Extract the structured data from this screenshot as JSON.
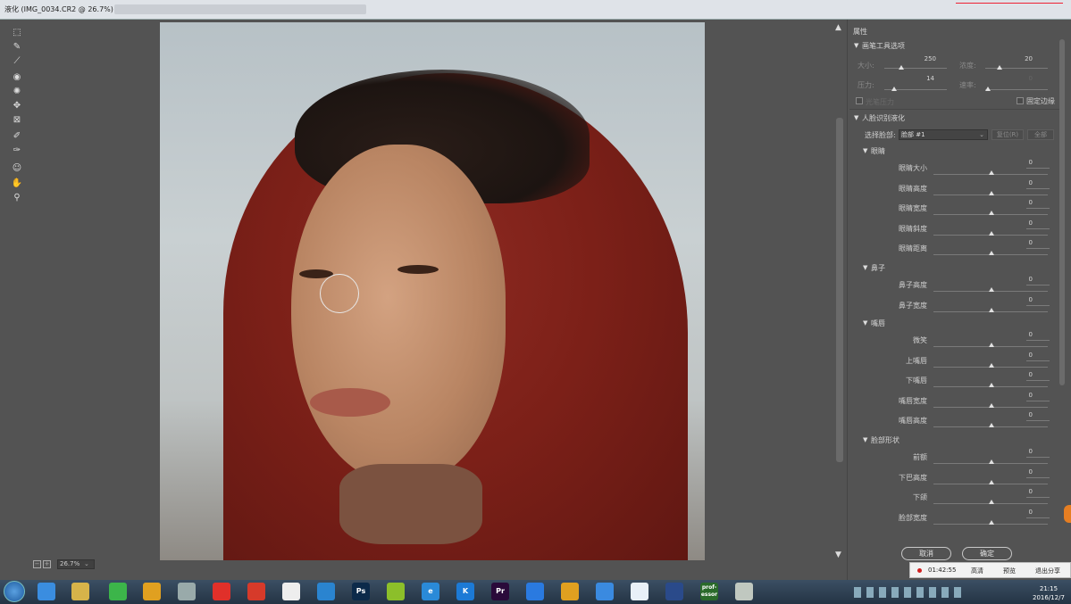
{
  "window": {
    "title": "液化 (IMG_0034.CR2 @ 26.7%)"
  },
  "tools": [
    {
      "name": "forward-warp-tool",
      "glyph": "⬚"
    },
    {
      "name": "reconstruct-tool",
      "glyph": "✎"
    },
    {
      "name": "smooth-tool",
      "glyph": "⟋"
    },
    {
      "name": "twirl-tool",
      "glyph": "◉"
    },
    {
      "name": "pucker-tool",
      "glyph": "✺"
    },
    {
      "name": "bloat-tool",
      "glyph": "✥"
    },
    {
      "name": "push-left-tool",
      "glyph": "⊠"
    },
    {
      "name": "freeze-mask-tool",
      "glyph": "✐"
    },
    {
      "name": "thaw-mask-tool",
      "glyph": "✑"
    },
    {
      "name": "face-tool",
      "glyph": "☺"
    },
    {
      "name": "hand-tool",
      "glyph": "✋"
    },
    {
      "name": "zoom-tool",
      "glyph": "⚲"
    }
  ],
  "status": {
    "zoom": "26.7%"
  },
  "panel": {
    "header": "属性",
    "brush_section": "画笔工具选项",
    "size_label": "大小:",
    "size_value": "250",
    "density_label": "浓度:",
    "density_value": "20",
    "pressure_label": "压力:",
    "pressure_value": "14",
    "rate_label": "速率:",
    "rate_value": "0",
    "stylus_label": "光笔压力",
    "pin_edges_label": "固定边缘",
    "face_section": "人脸识别液化",
    "select_face_label": "选择脸部:",
    "select_face_value": "脸部 #1",
    "reset_label": "复位(R)",
    "all_label": "全部",
    "eyes_section": "眼睛",
    "eye_sliders": [
      {
        "label": "眼睛大小",
        "value": "0"
      },
      {
        "label": "眼睛高度",
        "value": "0"
      },
      {
        "label": "眼睛宽度",
        "value": "0"
      },
      {
        "label": "眼睛斜度",
        "value": "0"
      },
      {
        "label": "眼睛距离",
        "value": "0"
      }
    ],
    "nose_section": "鼻子",
    "nose_sliders": [
      {
        "label": "鼻子高度",
        "value": "0"
      },
      {
        "label": "鼻子宽度",
        "value": "0"
      }
    ],
    "mouth_section": "嘴唇",
    "mouth_sliders": [
      {
        "label": "微笑",
        "value": "0"
      },
      {
        "label": "上嘴唇",
        "value": "0"
      },
      {
        "label": "下嘴唇",
        "value": "0"
      },
      {
        "label": "嘴唇宽度",
        "value": "0"
      },
      {
        "label": "嘴唇高度",
        "value": "0"
      }
    ],
    "faceshape_section": "脸部形状",
    "faceshape_sliders": [
      {
        "label": "前额",
        "value": "0"
      },
      {
        "label": "下巴高度",
        "value": "0"
      },
      {
        "label": "下颌",
        "value": "0"
      },
      {
        "label": "脸部宽度",
        "value": "0"
      }
    ],
    "cancel_label": "取消",
    "ok_label": "确定"
  },
  "recorder": {
    "time": "01:42:55",
    "hd": "高清",
    "preview": "预览",
    "exit": "退出分享"
  },
  "taskbar": {
    "apps": [
      {
        "name": "app-360",
        "label": "",
        "color": "#3a8de0"
      },
      {
        "name": "explorer",
        "label": "",
        "color": "#d6b34a"
      },
      {
        "name": "app-green",
        "label": "",
        "color": "#3cb54a"
      },
      {
        "name": "chrome",
        "label": "",
        "color": "#e0a020"
      },
      {
        "name": "app-cat",
        "label": "",
        "color": "#9aa"
      },
      {
        "name": "weibo",
        "label": "",
        "color": "#e0302a"
      },
      {
        "name": "netease-music",
        "label": "",
        "color": "#d63a2a"
      },
      {
        "name": "document",
        "label": "",
        "color": "#eeeeee"
      },
      {
        "name": "cloud",
        "label": "",
        "color": "#2a84d0"
      },
      {
        "name": "photoshop",
        "label": "Ps",
        "color": "#0c2a4a"
      },
      {
        "name": "app-yellow",
        "label": "",
        "color": "#8cbf2a"
      },
      {
        "name": "ie",
        "label": "e",
        "color": "#2a8ad8"
      },
      {
        "name": "kugou",
        "label": "K",
        "color": "#1c7ad6"
      },
      {
        "name": "premiere",
        "label": "Pr",
        "color": "#2a0a3a"
      },
      {
        "name": "pen-app",
        "label": "",
        "color": "#2a7ae0"
      },
      {
        "name": "chrome2",
        "label": "",
        "color": "#e0a020"
      },
      {
        "name": "baidu-cloud",
        "label": "",
        "color": "#3a8ae0"
      },
      {
        "name": "bird-app",
        "label": "",
        "color": "#e8f0f8"
      },
      {
        "name": "video-app",
        "label": "",
        "color": "#2a4a8a"
      },
      {
        "name": "professor",
        "label": "prof-essor",
        "color": "#2a6a2a"
      },
      {
        "name": "image-app",
        "label": "",
        "color": "#c0c8c0"
      }
    ],
    "time": "21:15",
    "date": "2016/12/7"
  }
}
